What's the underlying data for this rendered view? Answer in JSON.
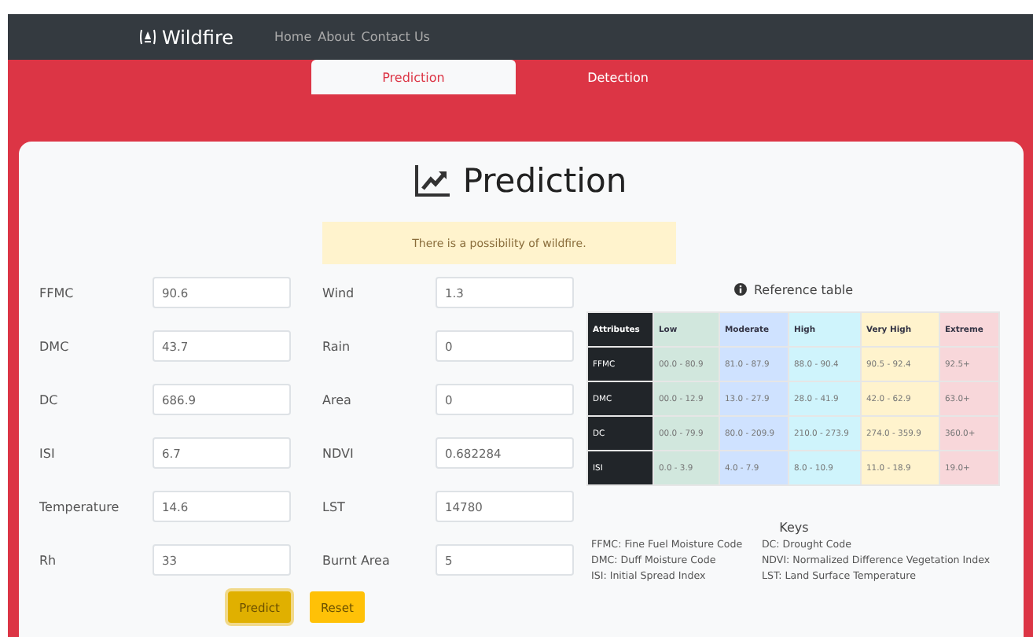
{
  "navbar": {
    "brand": "Wildfire",
    "links": [
      "Home",
      "About",
      "Contact Us"
    ]
  },
  "tabs": [
    {
      "label": "Prediction",
      "selected": true
    },
    {
      "label": "Detection",
      "selected": false
    }
  ],
  "title": "Prediction",
  "alert": "There is a possibility of wildfire.",
  "form": {
    "fields": [
      {
        "label": "FFMC",
        "value": "90.6"
      },
      {
        "label": "Wind",
        "value": "1.3"
      },
      {
        "label": "DMC",
        "value": "43.7"
      },
      {
        "label": "Rain",
        "value": "0"
      },
      {
        "label": "DC",
        "value": "686.9"
      },
      {
        "label": "Area",
        "value": "0"
      },
      {
        "label": "ISI",
        "value": "6.7"
      },
      {
        "label": "NDVI",
        "value": "0.682284"
      },
      {
        "label": "Temperature",
        "value": "14.6"
      },
      {
        "label": "LST",
        "value": "14780"
      },
      {
        "label": "Rh",
        "value": "33"
      },
      {
        "label": "Burnt Area",
        "value": "5"
      }
    ],
    "buttons": [
      {
        "label": "Predict",
        "pressed": true
      },
      {
        "label": "Reset",
        "pressed": false
      }
    ]
  },
  "reference": {
    "title": "Reference table",
    "columns": [
      {
        "label": "Attributes",
        "color": "#212529"
      },
      {
        "label": "Low",
        "color": "#d1e7dd"
      },
      {
        "label": "Moderate",
        "color": "#cfe2ff"
      },
      {
        "label": "High",
        "color": "#cff4fc"
      },
      {
        "label": "Very High",
        "color": "#fff3cd"
      },
      {
        "label": "Extreme",
        "color": "#f8d7da"
      }
    ],
    "rows": [
      [
        "FFMC",
        "00.0 - 80.9",
        "81.0 - 87.9",
        "88.0 - 90.4",
        "90.5 - 92.4",
        "92.5+"
      ],
      [
        "DMC",
        "00.0 - 12.9",
        "13.0 - 27.9",
        "28.0 - 41.9",
        "42.0 - 62.9",
        "63.0+"
      ],
      [
        "DC",
        "00.0 - 79.9",
        "80.0 - 209.9",
        "210.0 - 273.9",
        "274.0 - 359.9",
        "360.0+"
      ],
      [
        "ISI",
        "0.0 - 3.9",
        "4.0 - 7.9",
        "8.0 - 10.9",
        "11.0 - 18.9",
        "19.0+"
      ]
    ]
  },
  "keys": {
    "title": "Keys",
    "items": [
      "FFMC: Fine Fuel Moisture Code",
      "DC: Drought Code",
      "DMC: Duff Moisture Code",
      "NDVI: Normalized Difference Vegetation Index",
      "ISI: Initial Spread Index",
      "LST: Land Surface Temperature"
    ]
  }
}
